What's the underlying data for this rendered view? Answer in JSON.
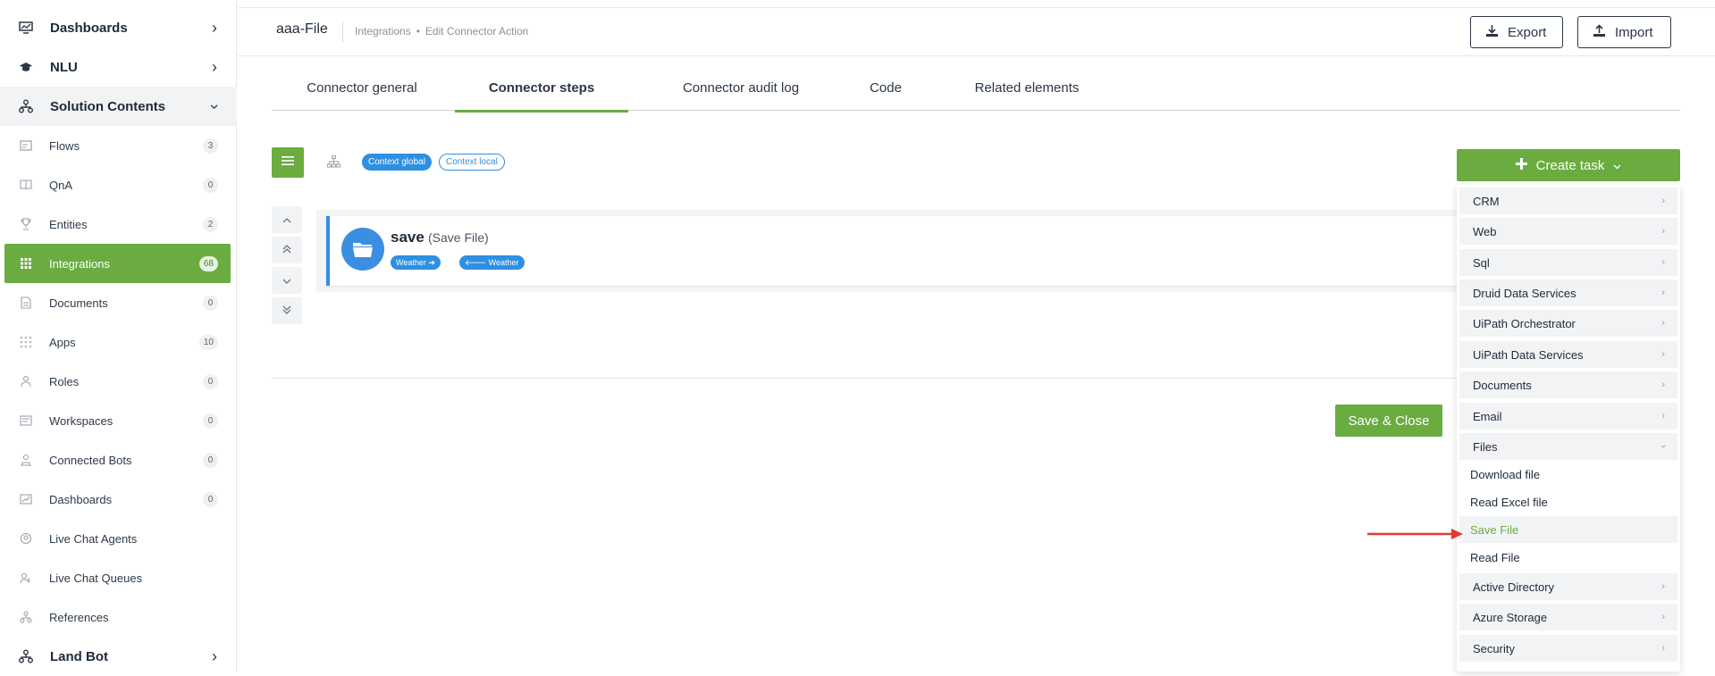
{
  "sidebar": {
    "groups": [
      {
        "label": "Dashboards",
        "icon": "dashboard-icon"
      },
      {
        "label": "NLU",
        "icon": "graduation-cap-icon"
      },
      {
        "label": "Solution Contents",
        "icon": "sitemap-icon"
      },
      {
        "label": "Land Bot",
        "icon": "sitemap-icon"
      }
    ],
    "items": [
      {
        "label": "Flows",
        "badge": "3",
        "icon": "flow-icon"
      },
      {
        "label": "QnA",
        "badge": "0",
        "icon": "book-icon"
      },
      {
        "label": "Entities",
        "badge": "2",
        "icon": "trophy-icon"
      },
      {
        "label": "Integrations",
        "badge": "68",
        "icon": "grid-icon"
      },
      {
        "label": "Documents",
        "badge": "0",
        "icon": "document-icon"
      },
      {
        "label": "Apps",
        "badge": "10",
        "icon": "apps-icon"
      },
      {
        "label": "Roles",
        "badge": "0",
        "icon": "roles-icon"
      },
      {
        "label": "Workspaces",
        "badge": "0",
        "icon": "workspace-icon"
      },
      {
        "label": "Connected Bots",
        "badge": "0",
        "icon": "bot-icon"
      },
      {
        "label": "Dashboards",
        "badge": "0",
        "icon": "chart-icon"
      },
      {
        "label": "Live Chat Agents",
        "badge": "",
        "icon": "agent-icon"
      },
      {
        "label": "Live Chat Queues",
        "badge": "",
        "icon": "queue-icon"
      },
      {
        "label": "References",
        "badge": "",
        "icon": "reference-icon"
      }
    ]
  },
  "header": {
    "title": "aaa-File",
    "breadcrumb": [
      "Integrations",
      "•",
      "Edit Connector Action"
    ],
    "export_label": "Export",
    "import_label": "Import"
  },
  "tabs": [
    "Connector general",
    "Connector steps",
    "Connector audit log",
    "Code",
    "Related elements"
  ],
  "active_tab": "Connector steps",
  "toolbar": {
    "context_global": "Context global",
    "context_local": "Context local"
  },
  "step": {
    "name": "save",
    "type": "(Save File)",
    "tag_out": "Weather ➔",
    "tag_in": "🡐 Weather"
  },
  "save_close_label": "Save & Close",
  "create_task": {
    "label": "Create task",
    "categories_top": [
      "CRM",
      "Web",
      "Sql",
      "Druid Data Services",
      "UiPath Orchestrator",
      "UiPath Data Services",
      "Documents",
      "Email",
      "Files"
    ],
    "files_items": [
      "Download file",
      "Read Excel file",
      "Save File",
      "Read File"
    ],
    "highlighted_item": "Save File",
    "categories_bottom": [
      "Active Directory",
      "Azure Storage",
      "Security"
    ]
  },
  "colors": {
    "accent_green": "#6aac3f",
    "accent_blue": "#2f8fe0",
    "arrow_red": "#e03c31"
  }
}
